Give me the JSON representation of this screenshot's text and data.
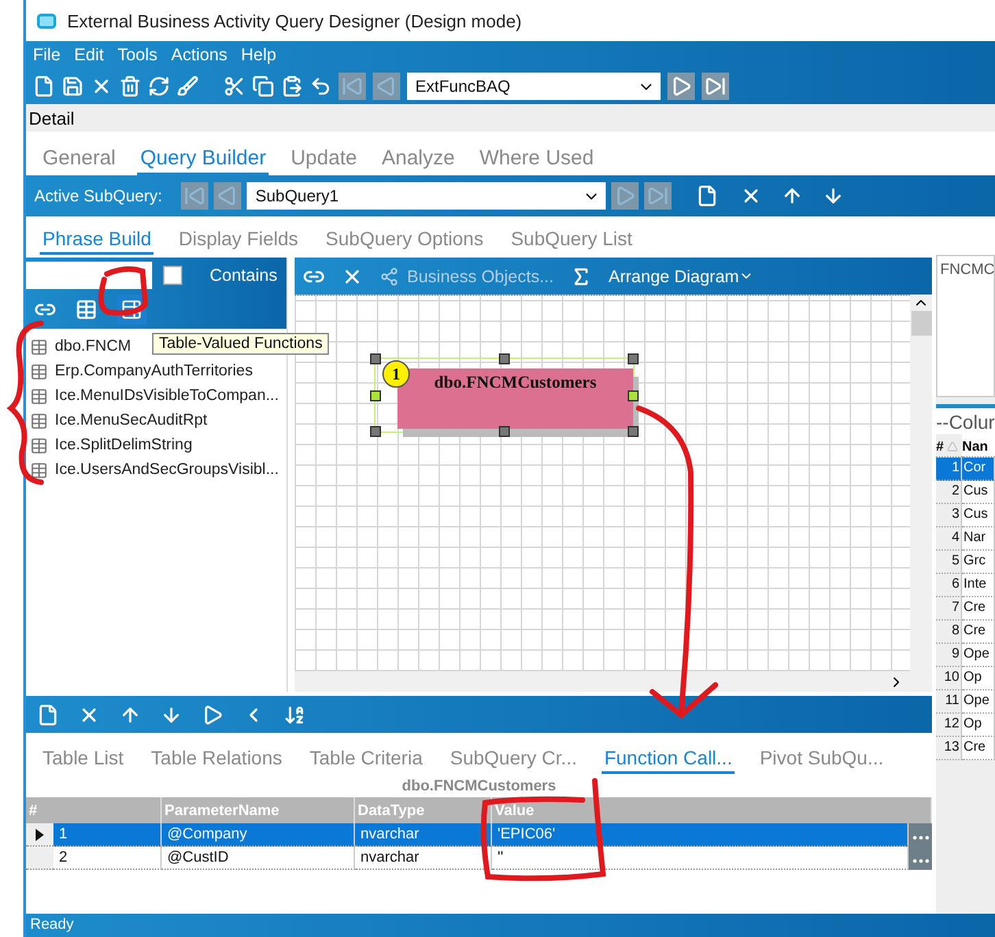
{
  "window": {
    "title": "External Business Activity Query Designer (Design mode)"
  },
  "menu": [
    "File",
    "Edit",
    "Tools",
    "Actions",
    "Help"
  ],
  "toolbar": {
    "query_id": "ExtFuncBAQ"
  },
  "section_label": "Detail",
  "tabs": [
    {
      "label": "General",
      "selected": false
    },
    {
      "label": "Query Builder",
      "selected": true
    },
    {
      "label": "Update",
      "selected": false
    },
    {
      "label": "Analyze",
      "selected": false
    },
    {
      "label": "Where Used",
      "selected": false
    }
  ],
  "subquery_bar": {
    "label": "Active SubQuery:",
    "value": "SubQuery1"
  },
  "sub_tabs": [
    {
      "label": "Phrase Build",
      "selected": true
    },
    {
      "label": "Display Fields",
      "selected": false
    },
    {
      "label": "SubQuery Options",
      "selected": false
    },
    {
      "label": "SubQuery List",
      "selected": false
    }
  ],
  "object_panel": {
    "contains_label": "Contains",
    "contains_checked": false,
    "tooltip": "Table-Valued Functions",
    "items": [
      "dbo.FNCM",
      "Erp.CompanyAuthTerritories",
      "Ice.MenuIDsVisibleToCompan...",
      "Ice.MenuSecAuditRpt",
      "Ice.SplitDelimString",
      "Ice.UsersAndSecGroupsVisibl..."
    ]
  },
  "diagram": {
    "business_objects": {
      "label": "Business Objects...",
      "disabled": true
    },
    "arrange_label": "Arrange Diagram",
    "tables": [
      {
        "number": "1",
        "name": "dbo.FNCMCustomers",
        "selected": true
      }
    ]
  },
  "bottom_tabs": [
    {
      "label": "Table List",
      "selected": false
    },
    {
      "label": "Table Relations",
      "selected": false
    },
    {
      "label": "Table Criteria",
      "selected": false
    },
    {
      "label": "SubQuery Cr...",
      "selected": false
    },
    {
      "label": "Function Call...",
      "selected": true
    },
    {
      "label": "Pivot SubQu...",
      "selected": false
    }
  ],
  "function_call": {
    "caption": "dbo.FNCMCustomers",
    "columns": [
      "#",
      "ParameterName",
      "DataType",
      "Value"
    ],
    "rows": [
      {
        "number": "1",
        "parameter": "@Company",
        "data_type": "nvarchar",
        "value": "'EPIC06'",
        "selected": true
      },
      {
        "number": "2",
        "parameter": "@CustID",
        "data_type": "nvarchar",
        "value": "''",
        "selected": false
      }
    ]
  },
  "side_panel": {
    "name": "FNCMC",
    "list_title": "--Colur",
    "columns": [
      "#",
      "Nan"
    ],
    "rows": [
      {
        "number": "1",
        "name": "Cor",
        "selected": true
      },
      {
        "number": "2",
        "name": "Cus",
        "selected": false
      },
      {
        "number": "3",
        "name": "Cus",
        "selected": false
      },
      {
        "number": "4",
        "name": "Nar",
        "selected": false
      },
      {
        "number": "5",
        "name": "Grc",
        "selected": false
      },
      {
        "number": "6",
        "name": "Inte",
        "selected": false
      },
      {
        "number": "7",
        "name": "Cre",
        "selected": false
      },
      {
        "number": "8",
        "name": "Cre",
        "selected": false
      },
      {
        "number": "9",
        "name": "Ope",
        "selected": false
      },
      {
        "number": "10",
        "name": "Op",
        "selected": false
      },
      {
        "number": "11",
        "name": "Ope",
        "selected": false
      },
      {
        "number": "12",
        "name": "Op",
        "selected": false
      },
      {
        "number": "13",
        "name": "Cre",
        "selected": false
      }
    ]
  },
  "status_bar": "Ready"
}
